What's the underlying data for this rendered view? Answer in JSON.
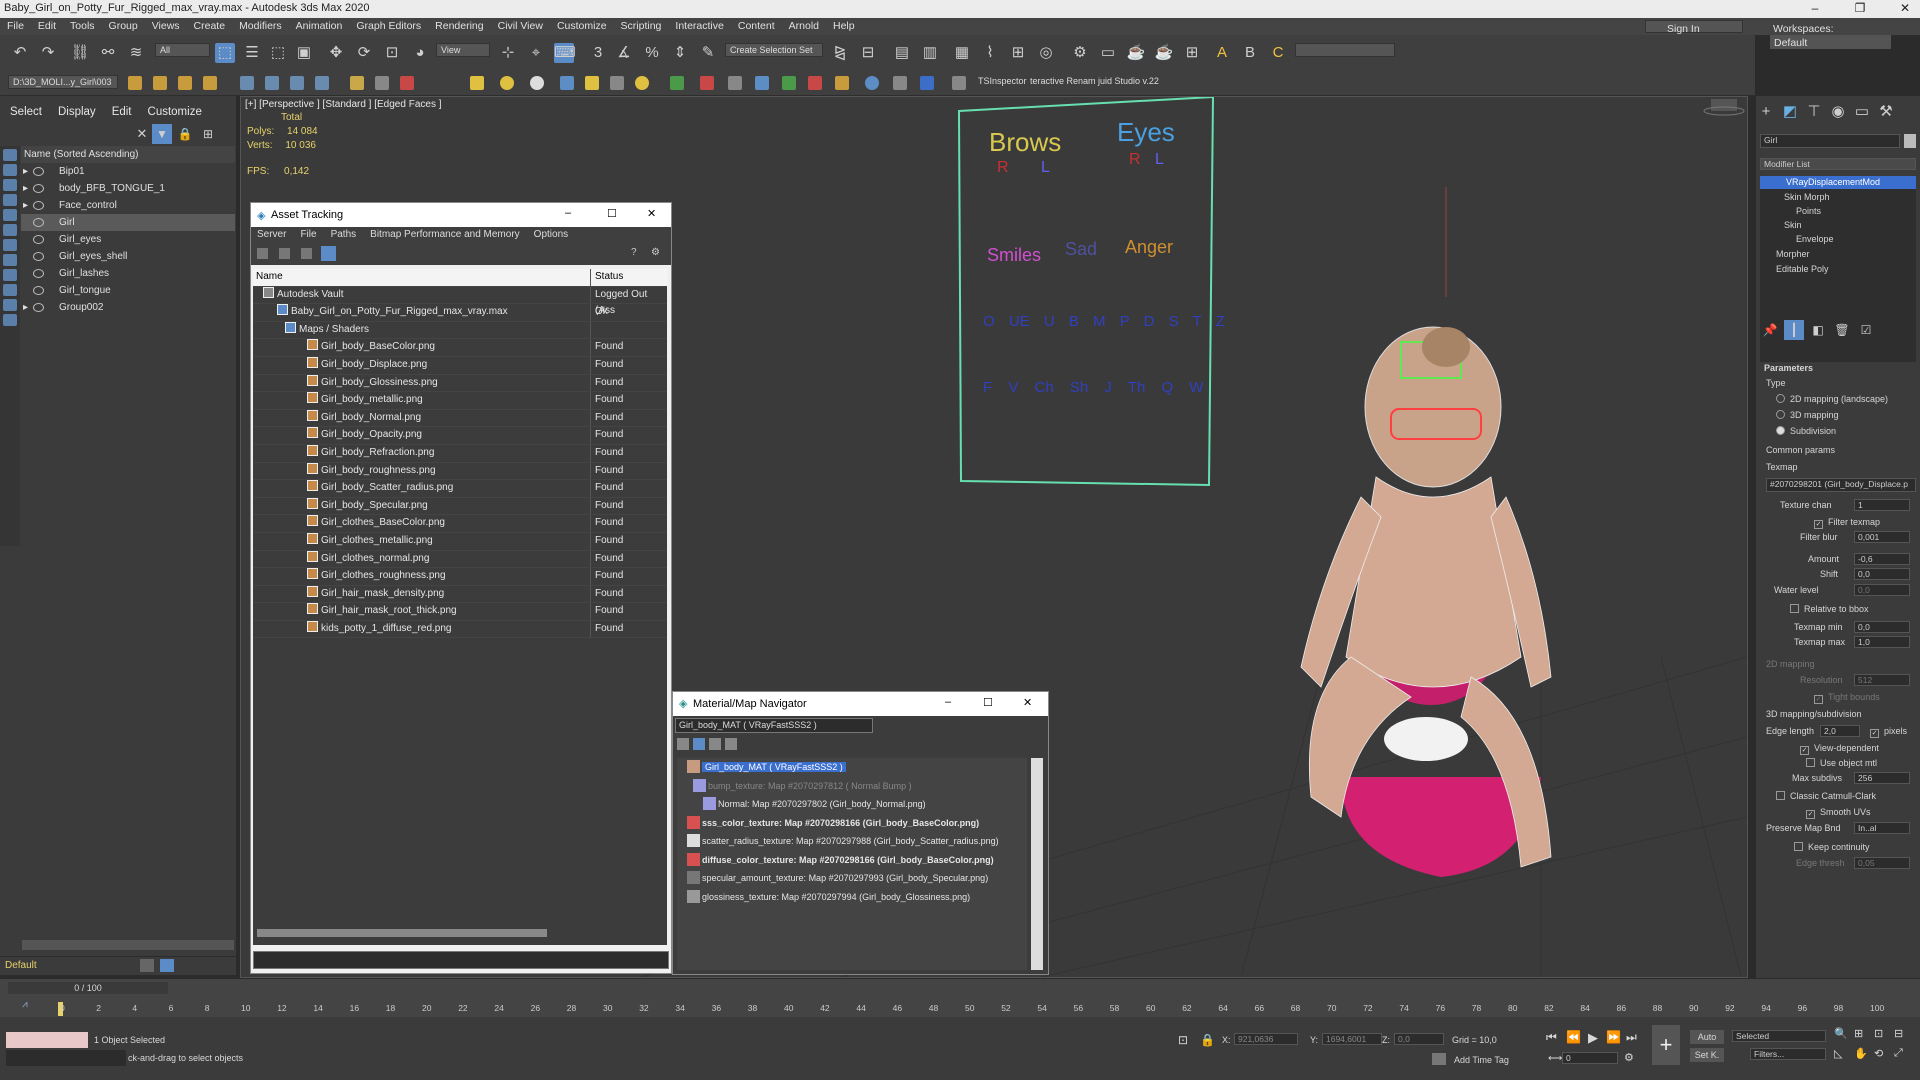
{
  "window": {
    "title": "Baby_Girl_on_Potty_Fur_Rigged_max_vray.max - Autodesk 3ds Max 2020"
  },
  "menu": [
    "File",
    "Edit",
    "Tools",
    "Group",
    "Views",
    "Create",
    "Modifiers",
    "Animation",
    "Graph Editors",
    "Rendering",
    "Civil View",
    "Customize",
    "Scripting",
    "Interactive",
    "Content",
    "Arnold",
    "Help"
  ],
  "signin": "Sign In",
  "workspaces": {
    "label": "Workspaces:",
    "value": "Default"
  },
  "toolbar": {
    "selection_filter": "All",
    "view_dropdown": "View",
    "create_selection_set": "Create Selection Set",
    "project_path": "D:\\3D_MOLI...y_Girl\\003",
    "tsinspector": "TSInspector",
    "renamer": "teractive Renam juid Studio v.22"
  },
  "scene_explorer": {
    "tabs": [
      "Select",
      "Display",
      "Edit",
      "Customize"
    ],
    "column": "Name (Sorted Ascending)",
    "items": [
      "Bip01",
      "body_BFB_TONGUE_1",
      "Face_control",
      "Girl",
      "Girl_eyes",
      "Girl_eyes_shell",
      "Girl_lashes",
      "Girl_tongue",
      "Group002"
    ],
    "layer": "Default"
  },
  "viewport": {
    "label": "[+] [Perspective ] [Standard ] [Edged Faces ]",
    "stats": {
      "total": "Total",
      "polys_label": "Polys:",
      "polys": "14 084",
      "verts_label": "Verts:",
      "verts": "10 036",
      "fps_label": "FPS:",
      "fps": "0,142"
    },
    "board": {
      "brows": "Brows",
      "eyes": "Eyes",
      "r": "R",
      "l": "L",
      "smiles": "Smiles",
      "sad": "Sad",
      "anger": "Anger",
      "row3": [
        "O UE",
        "U",
        "B M P",
        "D S T Z"
      ],
      "row4": [
        "F V",
        "Ch Sh J",
        "Th",
        "Q W"
      ]
    }
  },
  "asset_tracking": {
    "title": "Asset Tracking",
    "menu": [
      "Server",
      "File",
      "Paths",
      "Bitmap Performance and Memory",
      "Options"
    ],
    "columns": [
      "Name",
      "Status"
    ],
    "rows": [
      {
        "name": "Autodesk Vault",
        "status": "Logged Out (Ass"
      },
      {
        "name": "Baby_Girl_on_Potty_Fur_Rigged_max_vray.max",
        "status": "Ok"
      },
      {
        "name": "Maps / Shaders",
        "status": ""
      },
      {
        "name": "Girl_body_BaseColor.png",
        "status": "Found"
      },
      {
        "name": "Girl_body_Displace.png",
        "status": "Found"
      },
      {
        "name": "Girl_body_Glossiness.png",
        "status": "Found"
      },
      {
        "name": "Girl_body_metallic.png",
        "status": "Found"
      },
      {
        "name": "Girl_body_Normal.png",
        "status": "Found"
      },
      {
        "name": "Girl_body_Opacity.png",
        "status": "Found"
      },
      {
        "name": "Girl_body_Refraction.png",
        "status": "Found"
      },
      {
        "name": "Girl_body_roughness.png",
        "status": "Found"
      },
      {
        "name": "Girl_body_Scatter_radius.png",
        "status": "Found"
      },
      {
        "name": "Girl_body_Specular.png",
        "status": "Found"
      },
      {
        "name": "Girl_clothes_BaseColor.png",
        "status": "Found"
      },
      {
        "name": "Girl_clothes_metallic.png",
        "status": "Found"
      },
      {
        "name": "Girl_clothes_normal.png",
        "status": "Found"
      },
      {
        "name": "Girl_clothes_roughness.png",
        "status": "Found"
      },
      {
        "name": "Girl_hair_mask_density.png",
        "status": "Found"
      },
      {
        "name": "Girl_hair_mask_root_thick.png",
        "status": "Found"
      },
      {
        "name": "kids_potty_1_diffuse_red.png",
        "status": "Found"
      }
    ]
  },
  "material_navigator": {
    "title": "Material/Map Navigator",
    "current": "Girl_body_MAT  ( VRayFastSSS2 )",
    "items": [
      "Girl_body_MAT  ( VRayFastSSS2 )",
      "bump_texture: Map #2070297812  ( Normal Bump )",
      "Normal: Map #2070297802 (Girl_body_Normal.png)",
      "sss_color_texture: Map #2070298166 (Girl_body_BaseColor.png)",
      "scatter_radius_texture: Map #2070297988 (Girl_body_Scatter_radius.png)",
      "diffuse_color_texture: Map #2070298166 (Girl_body_BaseColor.png)",
      "specular_amount_texture: Map #2070297993 (Girl_body_Specular.png)",
      "glossiness_texture: Map #2070297994 (Girl_body_Glossiness.png)"
    ]
  },
  "command_panel": {
    "object_name": "Girl",
    "modifier_list": "Modifier List",
    "stack": [
      "VRayDisplacementMod",
      "Skin Morph",
      "Points",
      "Skin",
      "Envelope",
      "Morpher",
      "Editable Poly"
    ],
    "parameters": "Parameters",
    "type_label": "Type",
    "types": [
      "2D mapping (landscape)",
      "3D mapping",
      "Subdivision"
    ],
    "common_params": "Common params",
    "texmap_label": "Texmap",
    "texmap": "#2070298201 (Girl_body_Displace.p",
    "texture_chan_label": "Texture chan",
    "texture_chan": "1",
    "filter_texmap": "Filter texmap",
    "filter_blur_label": "Filter blur",
    "filter_blur": "0,001",
    "amount_label": "Amount",
    "amount": "-0,6",
    "shift_label": "Shift",
    "shift": "0,0",
    "water_level_label": "Water level",
    "water_level": "0,0",
    "relative_to_bbox": "Relative to bbox",
    "texmap_min_label": "Texmap min",
    "texmap_min": "0,0",
    "texmap_max_label": "Texmap max",
    "texmap_max": "1,0",
    "mapping_2d": "2D mapping",
    "resolution_label": "Resolution",
    "resolution": "512",
    "tight_bounds": "Tight bounds",
    "mapping_3d": "3D mapping/subdivision",
    "edge_length_label": "Edge length",
    "edge_length": "2,0",
    "pixels": "pixels",
    "view_dependent": "View-dependent",
    "use_object_mtl": "Use object mtl",
    "max_subdivs_label": "Max subdivs",
    "max_subdivs": "256",
    "classic_catmull": "Classic Catmull-Clark",
    "smooth_uvs": "Smooth UVs",
    "preserve_map_bnd_label": "Preserve Map Bnd",
    "preserve_map_bnd": "In..al",
    "keep_continuity": "Keep continuity",
    "edge_thresh_label": "Edge thresh",
    "edge_thresh": "0,05"
  },
  "timeline": {
    "frame": "0 / 100",
    "ticks": [
      "0",
      "2",
      "4",
      "6",
      "8",
      "10",
      "12",
      "14",
      "16",
      "18",
      "20",
      "22",
      "24",
      "26",
      "28",
      "30",
      "32",
      "34",
      "36",
      "38",
      "40",
      "42",
      "44",
      "46",
      "48",
      "50",
      "52",
      "54",
      "56",
      "58",
      "60",
      "62",
      "64",
      "66",
      "68",
      "70",
      "72",
      "74",
      "76",
      "78",
      "80",
      "82",
      "84",
      "86",
      "88",
      "90",
      "92",
      "94",
      "96",
      "98",
      "100"
    ]
  },
  "status": {
    "selected": "1 Object Selected",
    "prompt": "ck-and-drag to select objects",
    "x_label": "X:",
    "x": "921,0636",
    "y_label": "Y:",
    "y": "1694,6001",
    "z_label": "Z:",
    "z": "0,0",
    "grid": "Grid = 10,0",
    "add_time_tag": "Add Time Tag",
    "auto": "Auto",
    "set_k": "Set K.",
    "selected_dd": "Selected",
    "filters": "Filters...",
    "frame_spin": "0"
  }
}
